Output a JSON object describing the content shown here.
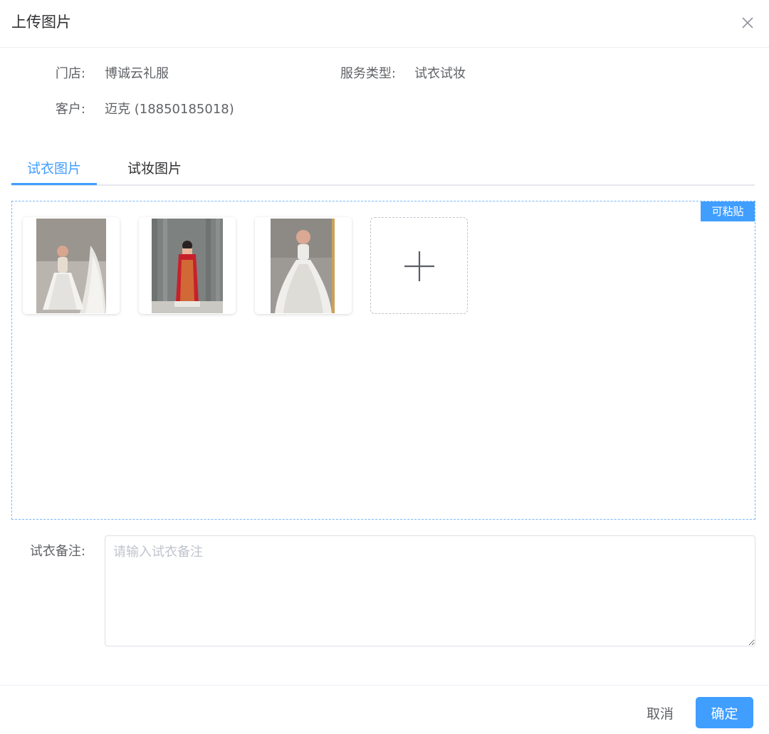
{
  "dialog": {
    "title": "上传图片",
    "close_icon": "close-icon"
  },
  "info": {
    "store_label": "门店:",
    "store_value": "博诚云礼服",
    "service_label": "服务类型:",
    "service_value": "试衣试妆",
    "customer_label": "客户:",
    "customer_value": "迈克 (18850185018)"
  },
  "tabs": [
    {
      "label": "试衣图片",
      "active": true
    },
    {
      "label": "试妆图片",
      "active": false
    }
  ],
  "upload": {
    "paste_badge": "可粘贴",
    "add_icon": "plus-icon",
    "images": [
      {
        "name": "white-wedding-gown-photo"
      },
      {
        "name": "red-chinese-wedding-dress-photo"
      },
      {
        "name": "white-ball-gown-photo"
      }
    ]
  },
  "remark": {
    "label": "试衣备注:",
    "placeholder": "请输入试衣备注",
    "value": ""
  },
  "footer": {
    "cancel_label": "取消",
    "confirm_label": "确定"
  },
  "colors": {
    "primary": "#409eff",
    "text": "#303133",
    "secondary_text": "#606266",
    "placeholder": "#c0c4cc"
  }
}
